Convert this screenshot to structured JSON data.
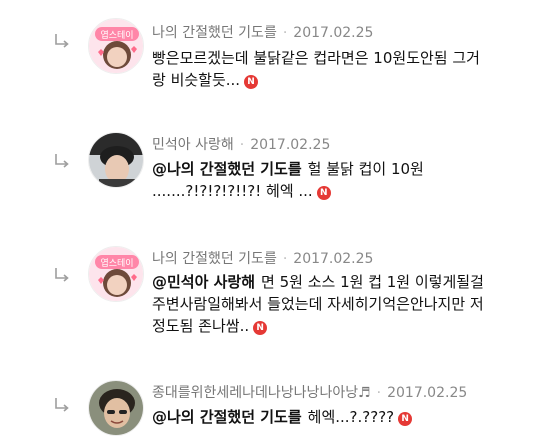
{
  "comments": [
    {
      "author": "나의 간절했던 기도를",
      "date": "2017.02.25",
      "avatar_label": "엽스테이",
      "mention": "",
      "lines": [
        "빵은모르겠는데 불닭같은 컵라면은 10원도안됨 그거",
        "랑 비슷할듯..."
      ],
      "badge": "N"
    },
    {
      "author": "민석아 사랑해",
      "date": "2017.02.25",
      "avatar_label": "",
      "mention": "@나의 간절했던 기도를",
      "lines": [
        "헐 불닭 컵이 10원",
        ".......?!?!?!?!!?! 헤엑 ..."
      ],
      "badge": "N"
    },
    {
      "author": "나의 간절했던 기도를",
      "date": "2017.02.25",
      "avatar_label": "엽스테이",
      "mention": "@민석아 사랑해",
      "lines": [
        "면 5원 소스 1원 컵 1원 이렇게될걸",
        "주변사람일해봐서 들었는데 자세히기억은안나지만 저",
        "정도됨 존나쌈.."
      ],
      "badge": "N"
    },
    {
      "author": "종대를위한세레나데나낭나낭나아낭♬",
      "date": "2017.02.25",
      "avatar_label": "",
      "mention": "@나의 간절했던 기도를",
      "lines": [
        "헤엑...?.????"
      ],
      "badge": "N"
    }
  ]
}
